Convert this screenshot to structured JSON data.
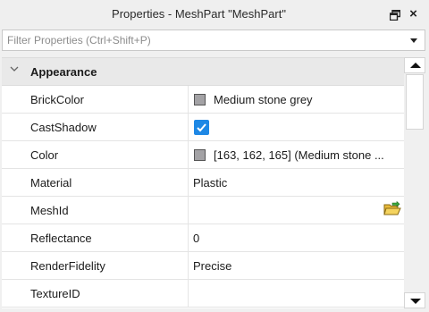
{
  "window": {
    "title": "Properties - MeshPart \"MeshPart\"",
    "restore_icon": "restore-window-icon",
    "close_glyph": "×"
  },
  "filter": {
    "placeholder": "Filter Properties (Ctrl+Shift+P)",
    "value": ""
  },
  "category": {
    "label": "Appearance",
    "expanded": true
  },
  "properties": [
    {
      "name": "BrickColor",
      "value": "Medium stone grey",
      "swatch": "#a3a2a5"
    },
    {
      "name": "CastShadow",
      "checked": true
    },
    {
      "name": "Color",
      "value": "[163, 162, 165] (Medium stone ...",
      "swatch": "#a3a2a5"
    },
    {
      "name": "Material",
      "value": "Plastic"
    },
    {
      "name": "MeshId",
      "value": "",
      "icon": "open-folder-icon"
    },
    {
      "name": "Reflectance",
      "value": "0"
    },
    {
      "name": "RenderFidelity",
      "value": "Precise"
    },
    {
      "name": "TextureID",
      "value": ""
    }
  ],
  "colors": {
    "checkbox": "#1e88e5",
    "category_bg": "#e9e9e9",
    "panel_bg": "#f0f0f0"
  }
}
